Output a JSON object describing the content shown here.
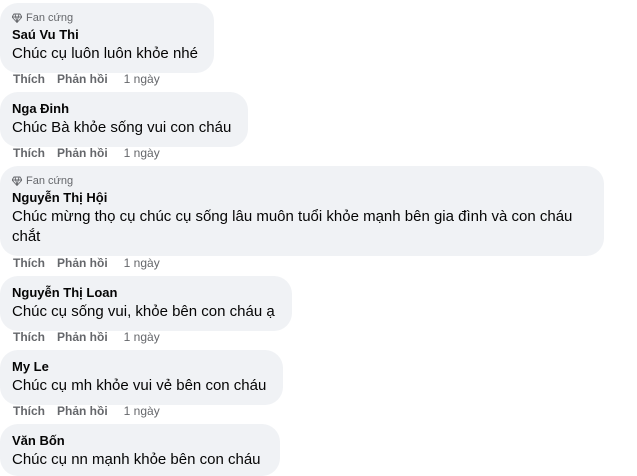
{
  "comments": [
    {
      "badge": "Fan cứng",
      "name": "Saú Vu Thi",
      "text": "Chúc cụ luôn luôn khỏe nhé",
      "like": "Thích",
      "reply": "Phản hồi",
      "time": "1 ngày"
    },
    {
      "badge": "",
      "name": "Nga Đinh",
      "text": "Chúc Bà khỏe sống vui con cháu",
      "like": "Thích",
      "reply": "Phản hồi",
      "time": "1 ngày"
    },
    {
      "badge": "Fan cứng",
      "name": "Nguyễn Thị Hội",
      "text": "Chúc mừng thọ cụ chúc cụ sống lâu muôn tuổi khỏe mạnh bên gia đình và con cháu chắt",
      "like": "Thích",
      "reply": "Phản hồi",
      "time": "1 ngày"
    },
    {
      "badge": "",
      "name": "Nguyễn Thị Loan",
      "text": "Chúc cụ sống vui, khỏe bên con cháu ạ",
      "like": "Thích",
      "reply": "Phản hồi",
      "time": "1 ngày"
    },
    {
      "badge": "",
      "name": "My Le",
      "text": "Chúc cụ mh khỏe vui vẻ bên con cháu",
      "like": "Thích",
      "reply": "Phản hồi",
      "time": "1 ngày"
    },
    {
      "badge": "",
      "name": "Văn Bốn",
      "text": "Chúc cụ nn mạnh khỏe bên con cháu",
      "like": "",
      "reply": "",
      "time": ""
    }
  ]
}
